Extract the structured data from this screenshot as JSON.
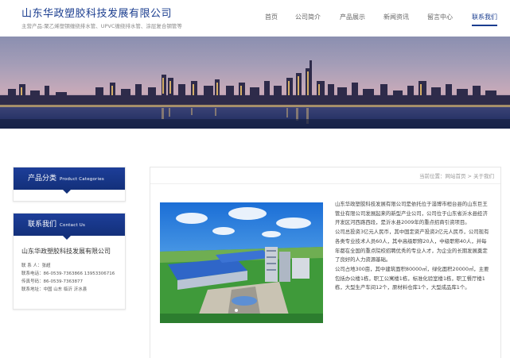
{
  "header": {
    "company": "山东华政塑胶科技发展有限公司",
    "subtitle": "主营产品:聚乙烯塑钢缠绕排水管、UPVC缠绕排水管、涂层复合钢管等"
  },
  "nav": [
    {
      "label": "首页",
      "active": false
    },
    {
      "label": "公司简介",
      "active": false
    },
    {
      "label": "产品展示",
      "active": false
    },
    {
      "label": "新闻资讯",
      "active": false
    },
    {
      "label": "留言中心",
      "active": false
    },
    {
      "label": "联系我们",
      "active": true
    }
  ],
  "sidebar": {
    "categories_title": "产品分类",
    "categories_title_en": "Product Categories",
    "contact_title": "联系我们",
    "contact_title_en": "Contact Us",
    "company": "山东华政塑胶科技发展有限公司",
    "lines": [
      "联 系 人：张超",
      "联系电话：86-0539-7363866   13953306716",
      "传真号码：86-0539-7363877",
      "联系地址：中国 山东 临沂 沂水县"
    ]
  },
  "breadcrumb": {
    "prefix": "当前位置：",
    "home": "网站首页",
    "separator": ">",
    "current": "关于我们"
  },
  "about": {
    "paragraphs": [
      "山东华政塑胶科技发展有限公司是依托位于淄博市桓台县的山东巨王管业有限公司发展起来的新型产业公司，公司位于山东省沂水县经济开发区河西路西段，是沂水县2009年的重点招商引资项目。",
      "公司总投资3亿元人民币，其中固定资产投资2亿元人民币，公司现有各类专业技术人员60人，其中高级职称20人，中级职称40人，并每年都在全国的重点院校招聘优秀的专业人才，为企业的长期发展奠定了良好的人力资源基础。",
      "公司占地300亩，其中建筑面积80000㎡，绿化面积20000㎡，主要包括办公楼1栋，职工公寓楼1栋，标准化验室楼1栋，职工餐厅楼1栋，大型生产车间12个，原材料仓库1个，大型成品库1个。"
    ]
  },
  "slider": {
    "count": 1,
    "active": 0
  },
  "colors": {
    "brand": "#1a3d8f",
    "sidebar_header": "#1d3e99"
  }
}
